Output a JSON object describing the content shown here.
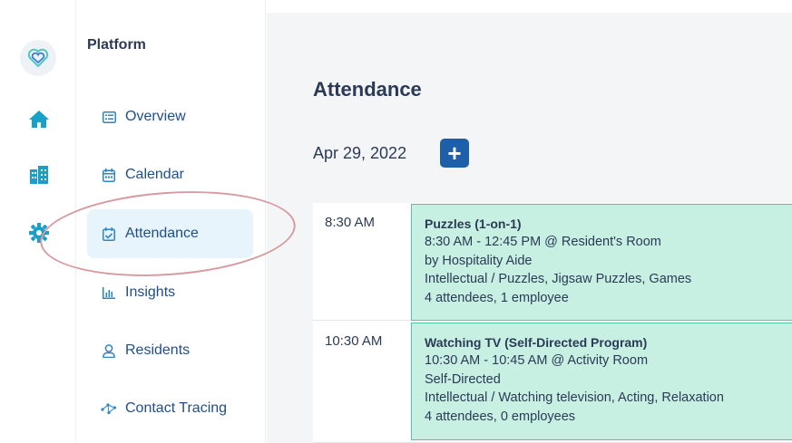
{
  "rail": {
    "items": [
      "heart-logo-icon",
      "home-icon",
      "buildings-icon",
      "gear-icon"
    ]
  },
  "sidebar": {
    "title": "Platform",
    "items": [
      {
        "label": "Overview",
        "icon": "list-icon"
      },
      {
        "label": "Calendar",
        "icon": "calendar-icon"
      },
      {
        "label": "Attendance",
        "icon": "calendar-check-icon",
        "active": true
      },
      {
        "label": "Insights",
        "icon": "bar-chart-icon"
      },
      {
        "label": "Residents",
        "icon": "user-icon"
      },
      {
        "label": "Contact Tracing",
        "icon": "network-icon"
      }
    ]
  },
  "main": {
    "title": "Attendance",
    "date": "Apr 29, 2022",
    "add_label": "+",
    "rows": [
      {
        "time": "8:30 AM",
        "event": {
          "title": "Puzzles (1-on-1)",
          "lines": [
            "8:30 AM - 12:45 PM @ Resident's Room",
            "by Hospitality Aide",
            "Intellectual / Puzzles, Jigsaw Puzzles, Games",
            "4 attendees, 1 employee"
          ]
        }
      },
      {
        "time": "10:30 AM",
        "event": {
          "title": "Watching TV (Self-Directed Program)",
          "lines": [
            "10:30 AM - 10:45 AM @ Activity Room",
            "Self-Directed",
            "Intellectual / Watching television, Acting, Relaxation",
            "4 attendees, 0 employees"
          ]
        }
      }
    ]
  },
  "colors": {
    "accent": "#1d5fa8",
    "active_bg": "#e8f4fb",
    "event_bg": "#c7f0e3",
    "event_border": "#4fc7a3",
    "annotation": "#d79aa0"
  }
}
